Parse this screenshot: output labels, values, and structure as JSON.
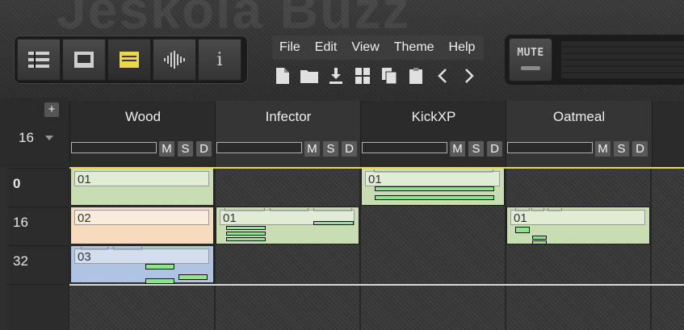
{
  "watermark": "Jeskola Buzz",
  "view_switcher": {
    "buttons": [
      {
        "name": "machine-list-view",
        "icon": "list-icon"
      },
      {
        "name": "machine-view",
        "icon": "window-icon"
      },
      {
        "name": "sequence-view",
        "icon": "sequence-icon",
        "active": true
      },
      {
        "name": "wave-view",
        "icon": "waveform-icon"
      },
      {
        "name": "info-view",
        "icon": "info-icon",
        "label": "i"
      }
    ]
  },
  "menu": {
    "items": [
      "File",
      "Edit",
      "View",
      "Theme",
      "Help"
    ]
  },
  "toolbar": {
    "icons": [
      "new-file-icon",
      "open-folder-icon",
      "download-icon",
      "grid-icon",
      "copy-icon",
      "clipboard-icon",
      "back-icon",
      "forward-icon"
    ]
  },
  "mute": {
    "label": "MUTE"
  },
  "sequence": {
    "add_button": "+",
    "rows_per_pattern": "16",
    "tracks": [
      {
        "name": "Wood"
      },
      {
        "name": "Infector"
      },
      {
        "name": "KickXP"
      },
      {
        "name": "Oatmeal"
      }
    ],
    "track_buttons": [
      "M",
      "S",
      "D"
    ],
    "rows": [
      "0",
      "16",
      "32"
    ],
    "patterns": [
      {
        "track": 0,
        "row": 0,
        "label": "01",
        "color": "#c8ddb2"
      },
      {
        "track": 0,
        "row": 1,
        "label": "02",
        "color": "#f6dcbc"
      },
      {
        "track": 0,
        "row": 2,
        "label": "03",
        "color": "#aec4e2"
      },
      {
        "track": 1,
        "row": 1,
        "label": "01",
        "color": "#c8ddb2"
      },
      {
        "track": 2,
        "row": 0,
        "label": "01",
        "color": "#c8ddb2"
      },
      {
        "track": 3,
        "row": 1,
        "label": "01",
        "color": "#c8ddb2"
      }
    ]
  },
  "colors": {
    "accent": "#e8d84a",
    "note": "#8ce48c"
  }
}
